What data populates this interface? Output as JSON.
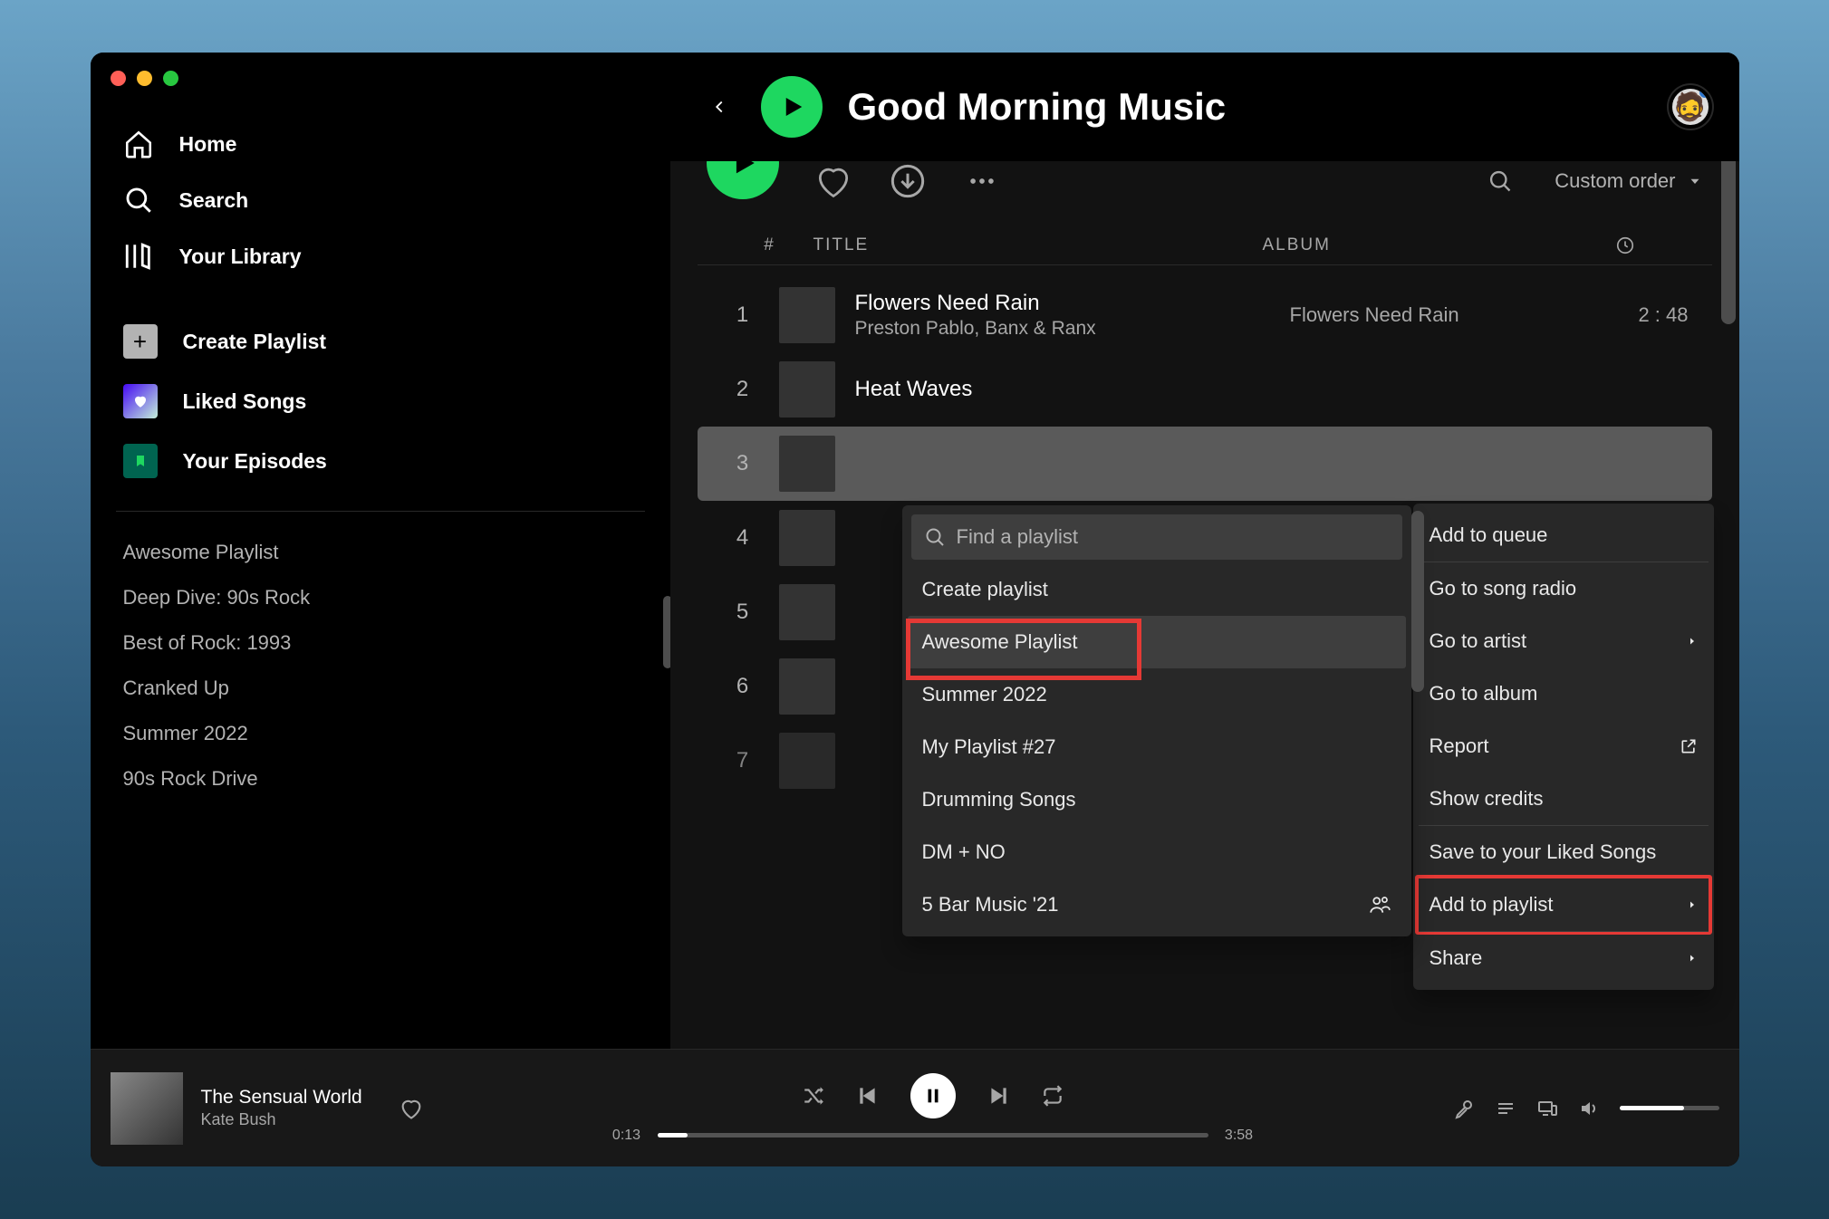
{
  "sidebar": {
    "nav": {
      "home": "Home",
      "search": "Search",
      "library": "Your Library"
    },
    "actions": {
      "create_playlist": "Create Playlist",
      "liked_songs": "Liked Songs",
      "your_episodes": "Your Episodes"
    },
    "playlists": [
      "Awesome Playlist",
      "Deep Dive: 90s Rock",
      "Best of Rock: 1993",
      "Cranked Up",
      "Summer 2022",
      "90s Rock Drive"
    ]
  },
  "header": {
    "title": "Good Morning Music",
    "sort_label": "Custom order"
  },
  "table_headers": {
    "number": "#",
    "title": "TITLE",
    "album": "ALBUM"
  },
  "tracks": [
    {
      "num": "1",
      "name": "Flowers Need Rain",
      "artist": "Preston Pablo, Banx & Ranx",
      "album": "Flowers Need Rain",
      "duration": "2 : 48"
    },
    {
      "num": "2",
      "name": "Heat Waves",
      "artist": "",
      "album": "",
      "duration": ""
    },
    {
      "num": "3",
      "name": "",
      "artist": "",
      "album": "",
      "duration": ""
    },
    {
      "num": "4",
      "name": "",
      "artist": "",
      "album": "",
      "duration": ""
    },
    {
      "num": "5",
      "name": "",
      "artist": "",
      "album": "",
      "duration": ""
    },
    {
      "num": "6",
      "name": "",
      "artist": "",
      "album": "",
      "duration": ""
    },
    {
      "num": "7",
      "name": "",
      "artist": "",
      "album": "",
      "duration": ""
    }
  ],
  "context_menu": {
    "add_to_queue": "Add to queue",
    "go_to_song_radio": "Go to song radio",
    "go_to_artist": "Go to artist",
    "go_to_album": "Go to album",
    "report": "Report",
    "show_credits": "Show credits",
    "save_to_liked": "Save to your Liked Songs",
    "add_to_playlist": "Add to playlist",
    "share": "Share"
  },
  "playlist_submenu": {
    "search_placeholder": "Find a playlist",
    "create_playlist": "Create playlist",
    "items": [
      "Awesome Playlist",
      "Summer 2022",
      "My Playlist #27",
      "Drumming Songs",
      "DM + NO",
      "5 Bar Music '21"
    ]
  },
  "now_playing": {
    "title": "The Sensual World",
    "artist": "Kate Bush",
    "elapsed": "0:13",
    "total": "3:58",
    "progress_pct": 5.5
  }
}
